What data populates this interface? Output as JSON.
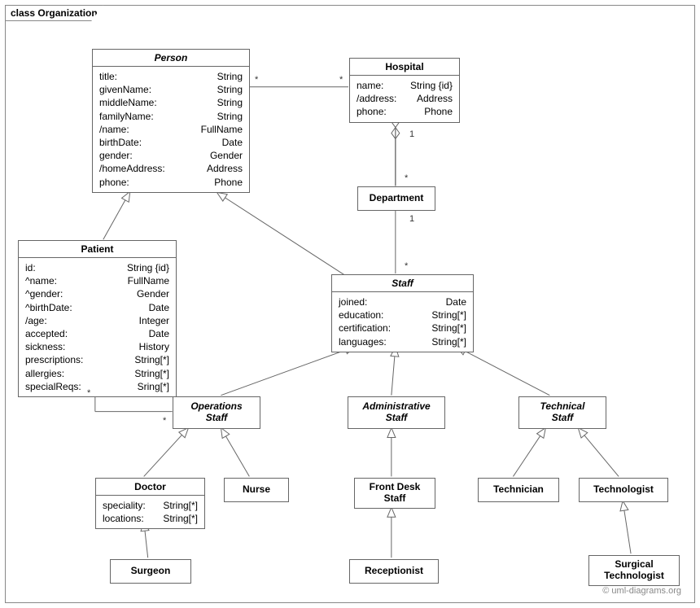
{
  "frame_label": "class Organization",
  "watermark": "© uml-diagrams.org",
  "classes": {
    "person": {
      "name": "Person",
      "attrs": [
        {
          "n": "title:",
          "t": "String"
        },
        {
          "n": "givenName:",
          "t": "String"
        },
        {
          "n": "middleName:",
          "t": "String"
        },
        {
          "n": "familyName:",
          "t": "String"
        },
        {
          "n": "/name:",
          "t": "FullName"
        },
        {
          "n": "birthDate:",
          "t": "Date"
        },
        {
          "n": "gender:",
          "t": "Gender"
        },
        {
          "n": "/homeAddress:",
          "t": "Address"
        },
        {
          "n": "phone:",
          "t": "Phone"
        }
      ]
    },
    "hospital": {
      "name": "Hospital",
      "attrs": [
        {
          "n": "name:",
          "t": "String {id}"
        },
        {
          "n": "/address:",
          "t": "Address"
        },
        {
          "n": "phone:",
          "t": "Phone"
        }
      ]
    },
    "department": {
      "name": "Department"
    },
    "patient": {
      "name": "Patient",
      "attrs": [
        {
          "n": "id:",
          "t": "String {id}"
        },
        {
          "n": "^name:",
          "t": "FullName"
        },
        {
          "n": "^gender:",
          "t": "Gender"
        },
        {
          "n": "^birthDate:",
          "t": "Date"
        },
        {
          "n": "/age:",
          "t": "Integer"
        },
        {
          "n": "accepted:",
          "t": "Date"
        },
        {
          "n": "sickness:",
          "t": "History"
        },
        {
          "n": "prescriptions:",
          "t": "String[*]"
        },
        {
          "n": "allergies:",
          "t": "String[*]"
        },
        {
          "n": "specialReqs:",
          "t": "Sring[*]"
        }
      ]
    },
    "staff": {
      "name": "Staff",
      "attrs": [
        {
          "n": "joined:",
          "t": "Date"
        },
        {
          "n": "education:",
          "t": "String[*]"
        },
        {
          "n": "certification:",
          "t": "String[*]"
        },
        {
          "n": "languages:",
          "t": "String[*]"
        }
      ]
    },
    "operations_staff": {
      "name": "Operations\nStaff"
    },
    "administrative_staff": {
      "name": "Administrative\nStaff"
    },
    "technical_staff": {
      "name": "Technical\nStaff"
    },
    "doctor": {
      "name": "Doctor",
      "attrs": [
        {
          "n": "speciality:",
          "t": "String[*]"
        },
        {
          "n": "locations:",
          "t": "String[*]"
        }
      ]
    },
    "nurse": {
      "name": "Nurse"
    },
    "front_desk": {
      "name": "Front Desk\nStaff"
    },
    "technician": {
      "name": "Technician"
    },
    "technologist": {
      "name": "Technologist"
    },
    "surgeon": {
      "name": "Surgeon"
    },
    "receptionist": {
      "name": "Receptionist"
    },
    "surgical_tech": {
      "name": "Surgical\nTechnologist"
    }
  },
  "mult": {
    "person_hosp_left": "*",
    "person_hosp_right": "*",
    "hosp_dept_top": "1",
    "hosp_dept_bot": "*",
    "dept_staff_top": "1",
    "dept_staff_bot": "*",
    "patient_ops_left": "*",
    "patient_ops_right": "*"
  }
}
